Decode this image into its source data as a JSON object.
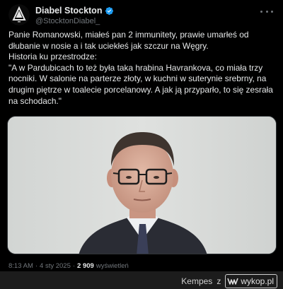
{
  "tweet": {
    "author_name": "Diabel Stockton",
    "handle": "@StocktonDiabel_",
    "text": "Panie Romanowski, miałeś pan 2 immunitety, prawie umarłeś od dłubanie w nosie a i tak uciekłeś jak szczur na Węgry.\nHistoria ku przestrodze:\n\"A w Pardubicach to też była taka hrabina Havrankova, co miała trzy nocniki. W salonie na parterze złoty, w kuchni w suterynie srebrny, na drugim piętrze w toalecie porcelanowy. A jak ją przyparło, to się zesrała na schodach.\"",
    "time": "8:13 AM",
    "date": "4 sty 2025",
    "views_count": "2 909",
    "views_label": "wyświetleń"
  },
  "credit": {
    "author": "Kempes",
    "joiner": "z",
    "site": "wykop.pl"
  },
  "colors": {
    "background": "#000000",
    "text": "#e7e9ea",
    "muted": "#71767b",
    "verified": "#1d9bf0"
  },
  "icons": [
    "avatar-logo",
    "verified-badge-icon",
    "more-options-icon",
    "wykop-logo-icon"
  ]
}
